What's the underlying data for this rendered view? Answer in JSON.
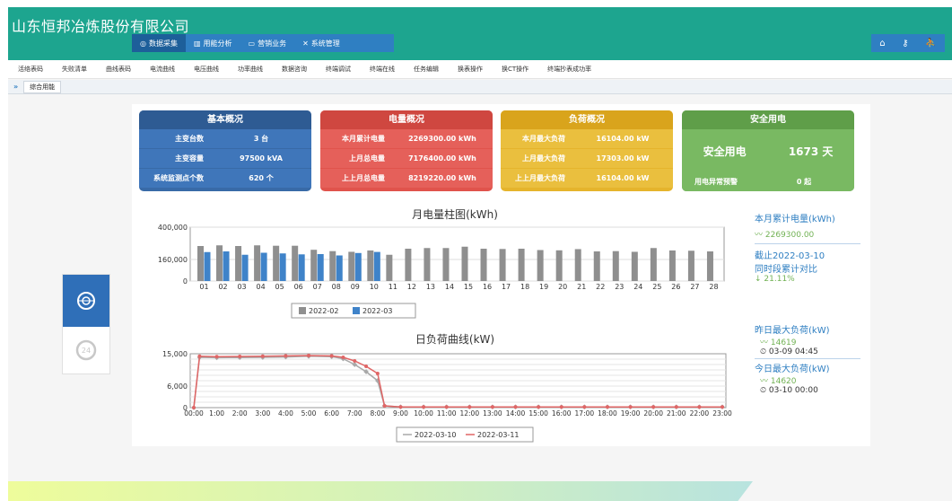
{
  "header": {
    "company": "山东恒邦冶炼股份有限公司",
    "nav": [
      {
        "label": "数据采集",
        "icon": "database-icon",
        "active": true
      },
      {
        "label": "用能分析",
        "icon": "bar-chart-icon",
        "active": false
      },
      {
        "label": "营销业务",
        "icon": "card-icon",
        "active": false
      },
      {
        "label": "系统管理",
        "icon": "tools-icon",
        "active": false
      }
    ],
    "icons": [
      "home-icon",
      "key-icon",
      "user-icon"
    ]
  },
  "subnav": [
    "活络表码",
    "失败清单",
    "曲线表码",
    "电流曲线",
    "电压曲线",
    "功率曲线",
    "数据咨询",
    "终端调试",
    "终端在线",
    "任务编辑",
    "换表操作",
    "换CT操作",
    "终端抄表成功率"
  ],
  "tabs": {
    "arrow": "»",
    "active": "综合用能"
  },
  "cards": {
    "basic": {
      "title": "基本概况",
      "color": "#386aa7",
      "rows": [
        {
          "k": "主变台数",
          "v": "3 台"
        },
        {
          "k": "主变容量",
          "v": "97500 kVA"
        },
        {
          "k": "系统监测点个数",
          "v": "620 个"
        }
      ]
    },
    "energy": {
      "title": "电量概况",
      "color": "#e0534c",
      "rows": [
        {
          "k": "本月累计电量",
          "v": "2269300.00 kWh"
        },
        {
          "k": "上月总电量",
          "v": "7176400.00 kWh"
        },
        {
          "k": "上上月总电量",
          "v": "8219220.00 kWh"
        }
      ]
    },
    "load": {
      "title": "负荷概况",
      "color": "#e5b42c",
      "rows": [
        {
          "k": "本月最大负荷",
          "v": "16104.00 kW"
        },
        {
          "k": "上月最大负荷",
          "v": "17303.00 kW"
        },
        {
          "k": "上上月最大负荷",
          "v": "16104.00 kW"
        }
      ]
    },
    "safety": {
      "title": "安全用电",
      "color": "#6fae57",
      "big_label": "安全用电",
      "big_value": "1673 天",
      "row": {
        "k": "用电异常预警",
        "v": "0 起"
      }
    }
  },
  "side_stats": {
    "month_label": "本月累计电量(kWh)",
    "month_value": "2269300.00",
    "compare_label1": "截止2022-03-10",
    "compare_label2": "同时段累计对比",
    "compare_value": "↓ 21.11%",
    "yest_label": "昨日最大负荷(kW)",
    "yest_value": "14619",
    "yest_time": "03-09 04:45",
    "today_label": "今日最大负荷(kW)",
    "today_value": "14620",
    "today_time": "03-10 00:00"
  },
  "colors": {
    "feb": "#8f8f8f",
    "mar": "#3f83c9",
    "d10": "#a9a9a9",
    "d11": "#e06666"
  },
  "chart_data": [
    {
      "type": "bar",
      "title": "月电量柱图(kWh)",
      "categories": [
        "01",
        "02",
        "03",
        "04",
        "05",
        "06",
        "07",
        "08",
        "09",
        "10",
        "11",
        "12",
        "13",
        "14",
        "15",
        "16",
        "17",
        "18",
        "19",
        "20",
        "21",
        "22",
        "23",
        "24",
        "25",
        "26",
        "27",
        "28"
      ],
      "ylim": [
        0,
        400000
      ],
      "yticks": [
        0,
        160000,
        400000
      ],
      "ytick_labels": [
        "0",
        "160,000",
        "400,000"
      ],
      "grid": true,
      "legend_position": "bottom",
      "series": [
        {
          "name": "2022-02",
          "color": "#8f8f8f",
          "values": [
            260000,
            265000,
            260000,
            265000,
            262000,
            262000,
            232000,
            222000,
            217000,
            227000,
            195000,
            240000,
            245000,
            245000,
            255000,
            240000,
            238000,
            240000,
            230000,
            228000,
            237000,
            220000,
            222000,
            217000,
            245000,
            227000,
            225000,
            220000
          ]
        },
        {
          "name": "2022-03",
          "color": "#3f83c9",
          "values": [
            215000,
            220000,
            195000,
            210000,
            205000,
            198000,
            200000,
            190000,
            208000,
            216000,
            null,
            null,
            null,
            null,
            null,
            null,
            null,
            null,
            null,
            null,
            null,
            null,
            null,
            null,
            null,
            null,
            null,
            null
          ]
        }
      ]
    },
    {
      "type": "line",
      "title": "日负荷曲线(kW)",
      "x": [
        "00:00",
        "1:00",
        "2:00",
        "3:00",
        "4:00",
        "5:00",
        "6:00",
        "7:00",
        "8:00",
        "9:00",
        "10:00",
        "11:00",
        "12:00",
        "13:00",
        "14:00",
        "15:00",
        "16:00",
        "17:00",
        "18:00",
        "19:00",
        "20:00",
        "21:00",
        "22:00",
        "23:00"
      ],
      "ylim": [
        0,
        15000
      ],
      "yticks": [
        0,
        6000,
        15000
      ],
      "ytick_labels": [
        "0",
        "6,000",
        "15,000"
      ],
      "grid": true,
      "legend_position": "bottom",
      "series": [
        {
          "name": "2022-03-10",
          "color": "#a9a9a9",
          "points": [
            [
              0,
              0
            ],
            [
              0.25,
              14000
            ],
            [
              1,
              13900
            ],
            [
              2,
              13950
            ],
            [
              3,
              14000
            ],
            [
              4,
              14100
            ],
            [
              5,
              14300
            ],
            [
              6,
              14200
            ],
            [
              6.5,
              13600
            ],
            [
              7,
              12000
            ],
            [
              7.5,
              10000
            ],
            [
              8,
              7500
            ],
            [
              8.3,
              500
            ],
            [
              9,
              200
            ],
            [
              10,
              200
            ],
            [
              11,
              200
            ],
            [
              12,
              200
            ],
            [
              13,
              200
            ],
            [
              14,
              200
            ],
            [
              15,
              200
            ],
            [
              16,
              200
            ],
            [
              17,
              200
            ],
            [
              18,
              200
            ],
            [
              19,
              200
            ],
            [
              20,
              200
            ],
            [
              21,
              200
            ],
            [
              22,
              200
            ],
            [
              23,
              200
            ]
          ]
        },
        {
          "name": "2022-03-11",
          "color": "#e06666",
          "points": [
            [
              0,
              0
            ],
            [
              0.25,
              14300
            ],
            [
              1,
              14200
            ],
            [
              2,
              14250
            ],
            [
              3,
              14300
            ],
            [
              4,
              14400
            ],
            [
              5,
              14500
            ],
            [
              6,
              14400
            ],
            [
              6.5,
              14000
            ],
            [
              7,
              13000
            ],
            [
              7.5,
              11500
            ],
            [
              8,
              9500
            ],
            [
              8.3,
              500
            ],
            [
              9,
              200
            ],
            [
              10,
              200
            ],
            [
              11,
              200
            ],
            [
              12,
              200
            ],
            [
              13,
              200
            ],
            [
              14,
              200
            ],
            [
              15,
              200
            ],
            [
              16,
              200
            ],
            [
              17,
              200
            ],
            [
              18,
              200
            ],
            [
              19,
              200
            ],
            [
              20,
              200
            ],
            [
              21,
              200
            ],
            [
              22,
              200
            ],
            [
              23,
              200
            ]
          ]
        }
      ]
    }
  ]
}
